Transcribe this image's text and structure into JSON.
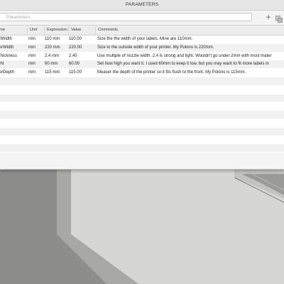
{
  "dialog": {
    "title": "PARAMETERS",
    "search_placeholder": "Parameters",
    "add_label": "+"
  },
  "table": {
    "headers": {
      "name": "me",
      "unit": "Unit",
      "expression": "Expression",
      "value": "Value",
      "comments": "Comments"
    },
    "rows": [
      {
        "name": "elWidth",
        "unit": "mm",
        "expression": "110 mm",
        "value": "110.00",
        "comment": "Size the the width of your labels. Mine are 110mm."
      },
      {
        "name": "terWidth",
        "unit": "mm",
        "expression": "220 mm",
        "value": "220.00",
        "comment": "Size to the outside width of your printer. My Polono is 220mm."
      },
      {
        "name": "Thickness",
        "unit": "mm",
        "expression": "2.4 mm",
        "value": "2.40",
        "comment": "Use multiple of nozzle width. 2.4 is strong and light. Wouldn't go under 2mm with most mater"
      },
      {
        "name": "ght",
        "unit": "mm",
        "expression": "60 mm",
        "value": "60.00",
        "comment": "Set how high you want it. I used 60mm to keep it low, but you may want to fit more labels in"
      },
      {
        "name": "terDepth",
        "unit": "mm",
        "expression": "115 mm",
        "value": "115.00",
        "comment": "Measer the depth of the printer so it fits flush to the front. My Polono is 115mm."
      }
    ]
  }
}
